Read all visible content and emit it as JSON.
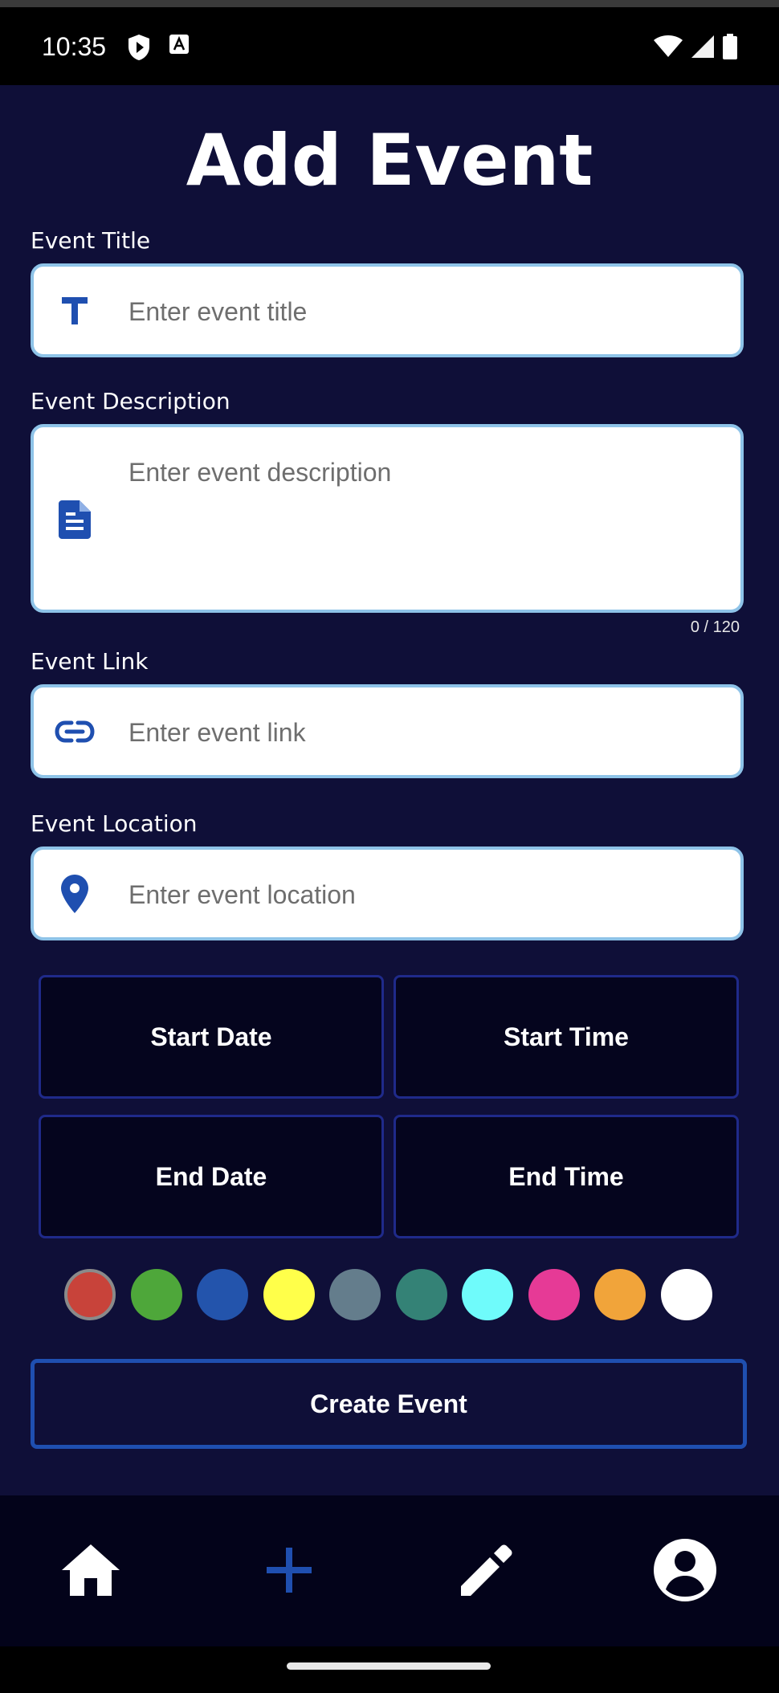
{
  "status_bar": {
    "time": "10:35",
    "icons_left": [
      "shield-play-icon",
      "font-a-icon"
    ],
    "icons_right": [
      "wifi-icon",
      "cellular-signal-icon",
      "battery-icon"
    ]
  },
  "page": {
    "title": "Add Event"
  },
  "form": {
    "title_field": {
      "label": "Event Title",
      "placeholder": "Enter event title",
      "value": "",
      "icon": "title-t-icon"
    },
    "description_field": {
      "label": "Event Description",
      "placeholder": "Enter event description",
      "value": "",
      "icon": "document-icon",
      "counter": "0 / 120"
    },
    "link_field": {
      "label": "Event Link",
      "placeholder": "Enter event link",
      "value": "",
      "icon": "link-icon"
    },
    "location_field": {
      "label": "Event Location",
      "placeholder": "Enter event location",
      "value": "",
      "icon": "location-pin-icon"
    }
  },
  "datetime": {
    "start_date_label": "Start Date",
    "start_time_label": "Start Time",
    "end_date_label": "End Date",
    "end_time_label": "End Time"
  },
  "colors": {
    "selected": "#c8433a",
    "options": [
      "#c8433a",
      "#4ea73a",
      "#2354ac",
      "#ffff4a",
      "#647d8c",
      "#348276",
      "#6ffbfb",
      "#e63a96",
      "#f1a43a",
      "#ffffff"
    ],
    "accent": "#1f4fb0",
    "field_border": "#8ec3e8",
    "background": "#0f0f38"
  },
  "actions": {
    "create_label": "Create Event"
  },
  "bottom_nav": {
    "items": [
      "home-icon",
      "add-icon",
      "edit-icon",
      "account-icon"
    ],
    "active": "add-icon"
  }
}
